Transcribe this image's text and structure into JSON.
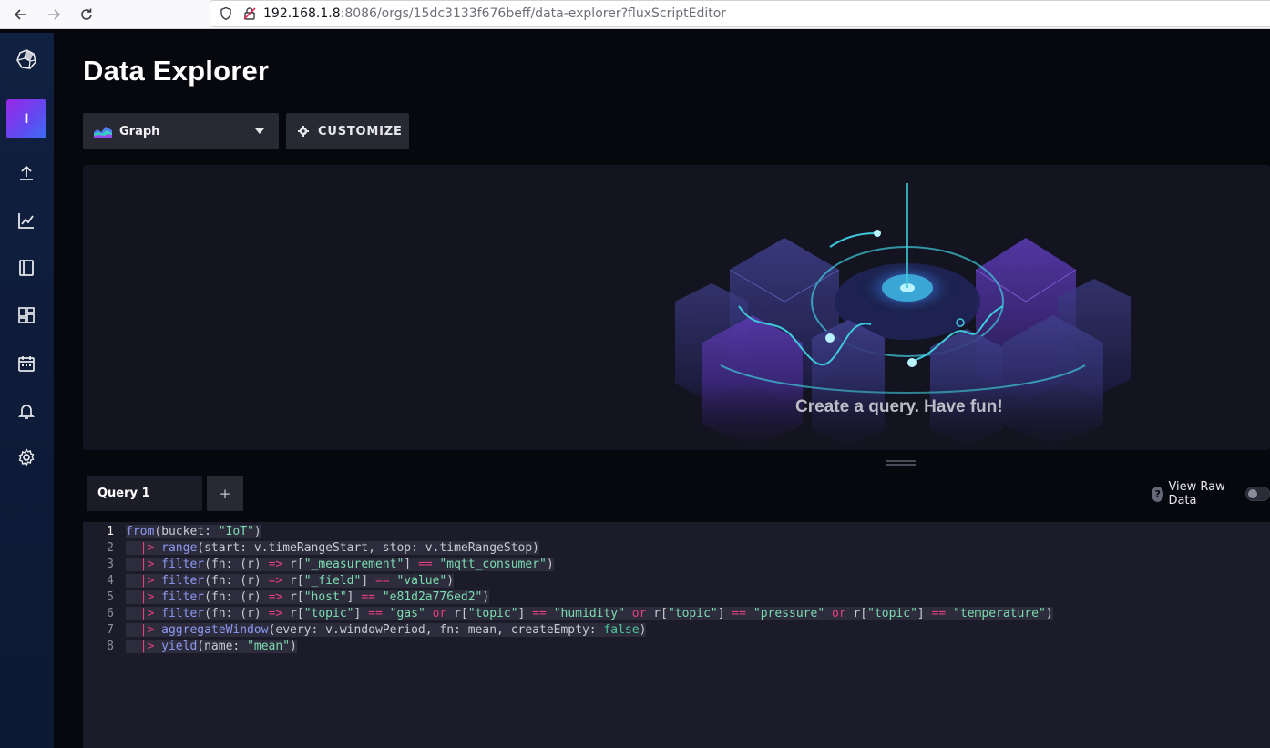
{
  "browser": {
    "url_host": "192.168.1.8",
    "url_rest": ":8086/orgs/15dc3133f676beff/data-explorer?fluxScriptEditor"
  },
  "sidebar": {
    "org_initial": "I",
    "items": [
      {
        "icon": "upload-icon"
      },
      {
        "icon": "graph-icon"
      },
      {
        "icon": "notebook-icon"
      },
      {
        "icon": "dashboards-icon"
      },
      {
        "icon": "calendar-icon"
      },
      {
        "icon": "bell-icon"
      },
      {
        "icon": "gear-icon"
      }
    ]
  },
  "header": {
    "title": "Data Explorer"
  },
  "toolbar": {
    "vis_type": "Graph",
    "customize_label": "CUSTOMIZE"
  },
  "vis": {
    "empty_message": "Create a query. Have fun!"
  },
  "queries": {
    "tabs": [
      {
        "label": "Query 1"
      }
    ],
    "add_label": "+",
    "raw_help": "?",
    "raw_label": "View Raw Data",
    "raw_enabled": false
  },
  "editor": {
    "active_line": 1,
    "lines": [
      {
        "n": "1",
        "t": "from(bucket: \"IoT\")"
      },
      {
        "n": "2",
        "t": "  |> range(start: v.timeRangeStart, stop: v.timeRangeStop)"
      },
      {
        "n": "3",
        "t": "  |> filter(fn: (r) => r[\"_measurement\"] == \"mqtt_consumer\")"
      },
      {
        "n": "4",
        "t": "  |> filter(fn: (r) => r[\"_field\"] == \"value\")"
      },
      {
        "n": "5",
        "t": "  |> filter(fn: (r) => r[\"host\"] == \"e81d2a776ed2\")"
      },
      {
        "n": "6",
        "t": "  |> filter(fn: (r) => r[\"topic\"] == \"gas\" or r[\"topic\"] == \"humidity\" or r[\"topic\"] == \"pressure\" or r[\"topic\"] == \"temperature\")"
      },
      {
        "n": "7",
        "t": "  |> aggregateWindow(every: v.windowPeriod, fn: mean, createEmpty: false)"
      },
      {
        "n": "8",
        "t": "  |> yield(name: \"mean\")"
      }
    ]
  },
  "colors": {
    "sidebar": "#102040",
    "accent_purple": "#9a28e6",
    "accent_blue": "#3a6ff5",
    "string": "#7cdcb0",
    "function": "#8e99f3",
    "operator": "#e83f7d"
  }
}
